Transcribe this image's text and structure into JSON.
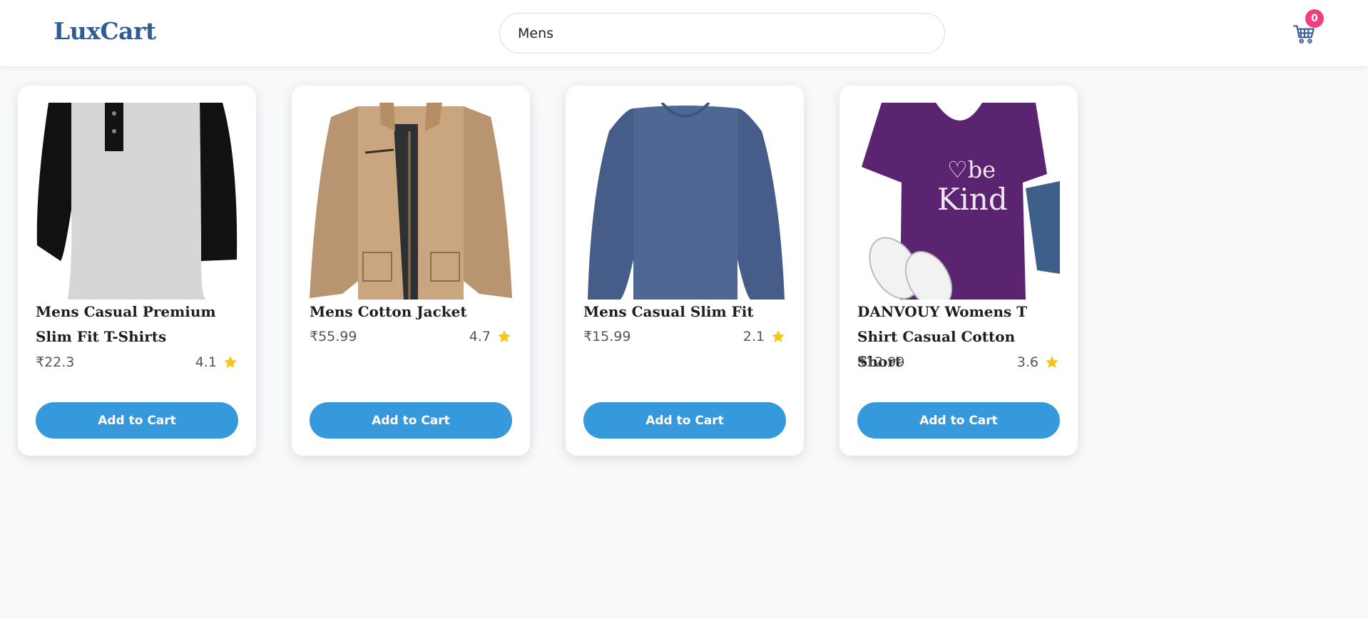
{
  "header": {
    "logo": "LuxCart",
    "search": {
      "value": "Mens",
      "placeholder": ""
    },
    "cart": {
      "icon": "shopping-cart-icon",
      "count": "0"
    }
  },
  "products": [
    {
      "title": "Mens Casual Premium Slim Fit T-Shirts",
      "price": "₹22.3",
      "rating": "4.1",
      "button": "Add to Cart",
      "image": "raglan-henley-tshirt"
    },
    {
      "title": "Mens Cotton Jacket",
      "price": "₹55.99",
      "rating": "4.7",
      "button": "Add to Cart",
      "image": "khaki-cotton-jacket"
    },
    {
      "title": "Mens Casual Slim Fit",
      "price": "₹15.99",
      "rating": "2.1",
      "button": "Add to Cart",
      "image": "blue-long-sleeve-shirt"
    },
    {
      "title": "DANVOUY Womens T Shirt Casual Cotton Short",
      "price": "₹12.99",
      "rating": "3.6",
      "button": "Add to Cart",
      "image": "purple-be-kind-tshirt"
    }
  ],
  "colors": {
    "logo": "#2f5d94",
    "accent": "#3599db",
    "badge": "#ee3f7f",
    "star": "#f5c518"
  }
}
